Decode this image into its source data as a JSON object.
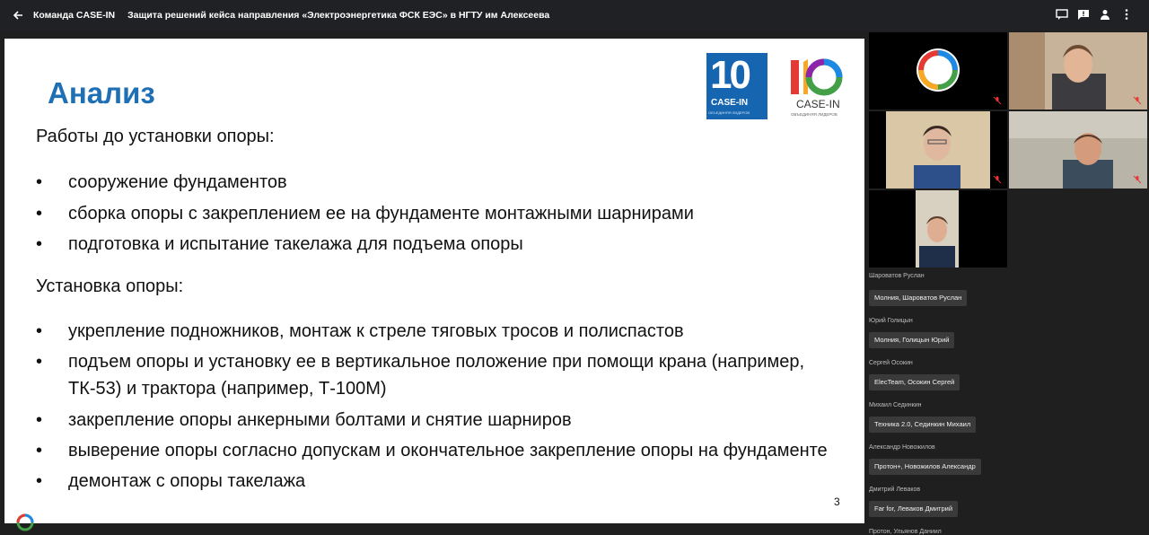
{
  "header": {
    "team": "Команда CASE-IN",
    "title": "Защита решений кейса направления «Электроэнергетика ФСК ЕЭС» в НГТУ им Алексеева"
  },
  "slide": {
    "title": "Анализ",
    "logo_blue": {
      "number": "10",
      "brand": "CASE-IN",
      "tag": "ОБЪЕДИНЯЯ ЛИДЕРОВ"
    },
    "logo_color": {
      "number": "10",
      "brand": "CASE-IN",
      "tag": "ОБЪЕДИНЯЯ ЛИДЕРОВ"
    },
    "section1": "Работы до установки опоры:",
    "bullets1": [
      "сооружение фундаментов",
      "сборка опоры с закреплением ее на фундаменте монтажными шарнирами",
      "подготовка и испытание такелажа для подъема опоры"
    ],
    "section2": "Установка опоры:",
    "bullets2": [
      "укрепление подножников, монтаж к стреле тяговых тросов и полиспастов",
      "подъем опоры и установку ее в вертикальное положение при помощи крана (например, ТК-53) и трактора (например, Т-100М)",
      "закрепление опоры анкерными болтами и снятие шарниров",
      "выверение опоры согласно допускам и окончательное закрепление опоры на фундаменте",
      "демонтаж с опоры такелажа"
    ],
    "bullet_mark": "•",
    "page_number": "3"
  },
  "participants": [
    {
      "label": "Шароватов Руслан",
      "chip": "Молния, Шароватов Руслан"
    },
    {
      "label": "Юрий Голицын",
      "chip": "Молния, Голицын Юрий"
    },
    {
      "label": "Сергей Осокин",
      "chip": "ElecTeam, Осокин Сергей"
    },
    {
      "label": "Михаил Сединкин",
      "chip": "Техника 2.0, Сединкин Михаил"
    },
    {
      "label": "Александр Новожилов",
      "chip": "Протон+, Новожилов Александр"
    },
    {
      "label": "Дмитрий Леваков",
      "chip": "Far for, Леваков Дмитрий"
    },
    {
      "label": "Протон, Ульянов Даниил",
      "chip": ""
    }
  ],
  "colors": {
    "accent_title": "#1f6fb5",
    "logo_blue": "#1565b1",
    "mic_off": "#e53935"
  }
}
